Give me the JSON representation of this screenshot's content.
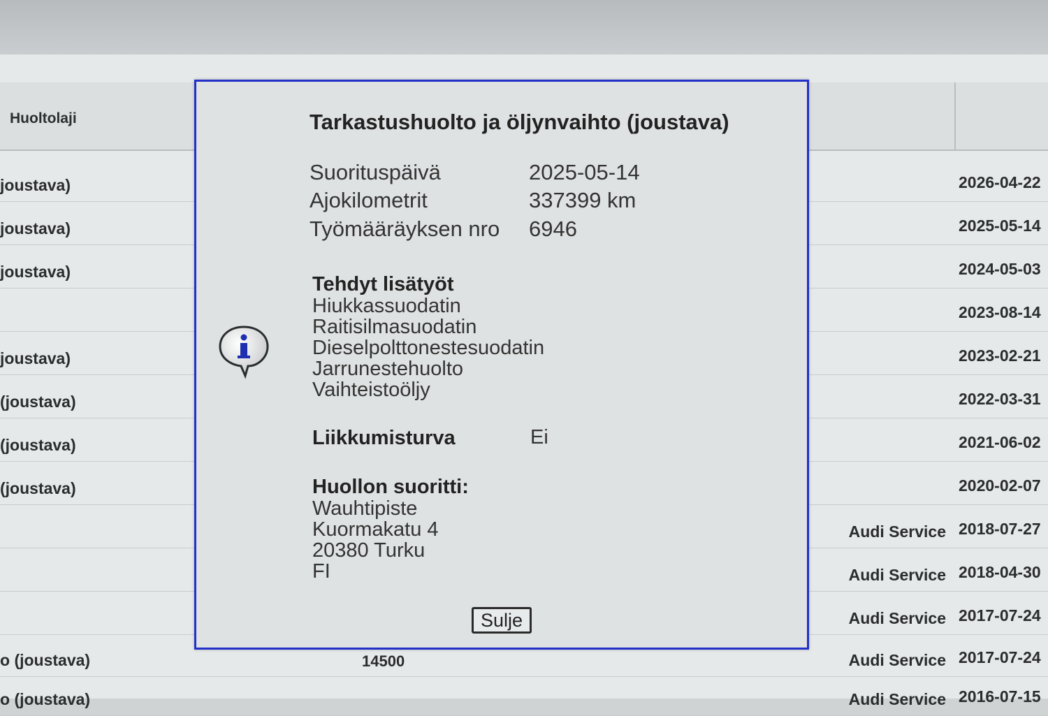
{
  "table": {
    "header": {
      "type_label": "Huoltolaji"
    },
    "rows": [
      {
        "type": "joustava)",
        "km": "",
        "shop": "",
        "date": "2026-04-22"
      },
      {
        "type": "joustava)",
        "km": "",
        "shop": "",
        "date": "2025-05-14"
      },
      {
        "type": "joustava)",
        "km": "",
        "shop": "",
        "date": "2024-05-03"
      },
      {
        "type": "",
        "km": "",
        "shop": "",
        "date": "2023-08-14"
      },
      {
        "type": "joustava)",
        "km": "",
        "shop": "",
        "date": "2023-02-21"
      },
      {
        "type": "(joustava)",
        "km": "",
        "shop": "",
        "date": "2022-03-31"
      },
      {
        "type": "(joustava)",
        "km": "",
        "shop": "",
        "date": "2021-06-02"
      },
      {
        "type": "(joustava)",
        "km": "",
        "shop": "",
        "date": "2020-02-07"
      },
      {
        "type": "",
        "km": "",
        "shop": "Audi Service",
        "date": "2018-07-27"
      },
      {
        "type": "",
        "km": "",
        "shop": "Audi Service",
        "date": "2018-04-30"
      },
      {
        "type": "",
        "km": "",
        "shop": "Audi Service",
        "date": "2017-07-24"
      },
      {
        "type": "o (joustava)",
        "km": "14500",
        "shop": "Audi Service",
        "date": "2017-07-24"
      },
      {
        "type": "o (joustava)",
        "km": "",
        "shop": "Audi Service",
        "date": "2016-07-15"
      }
    ]
  },
  "dialog": {
    "title": "Tarkastushuolto ja öljynvaihto (joustava)",
    "details": [
      {
        "label": "Suorituspäivä",
        "value": "2025-05-14"
      },
      {
        "label": "Ajokilometrit",
        "value": "337399 km"
      },
      {
        "label": "Työmääräyksen nro",
        "value": "6946"
      }
    ],
    "extra_work_title": "Tehdyt lisätyöt",
    "extra_work": [
      "Hiukkassuodatin",
      "Raitisilmasuodatin",
      "Dieselpolttonestesuodatin",
      "Jarrunestehuolto",
      "Vaihteistoöljy"
    ],
    "mobility": {
      "label": "Liikkumisturva",
      "value": "Ei"
    },
    "performer_title": "Huollon suoritti:",
    "performer": [
      "Wauhtipiste",
      "Kuormakatu 4",
      "20380 Turku",
      "FI"
    ],
    "close_label": "Sulje",
    "info_icon": "info-icon"
  },
  "colors": {
    "dialog_border": "#2230c8",
    "background": "#e6e9e9"
  }
}
